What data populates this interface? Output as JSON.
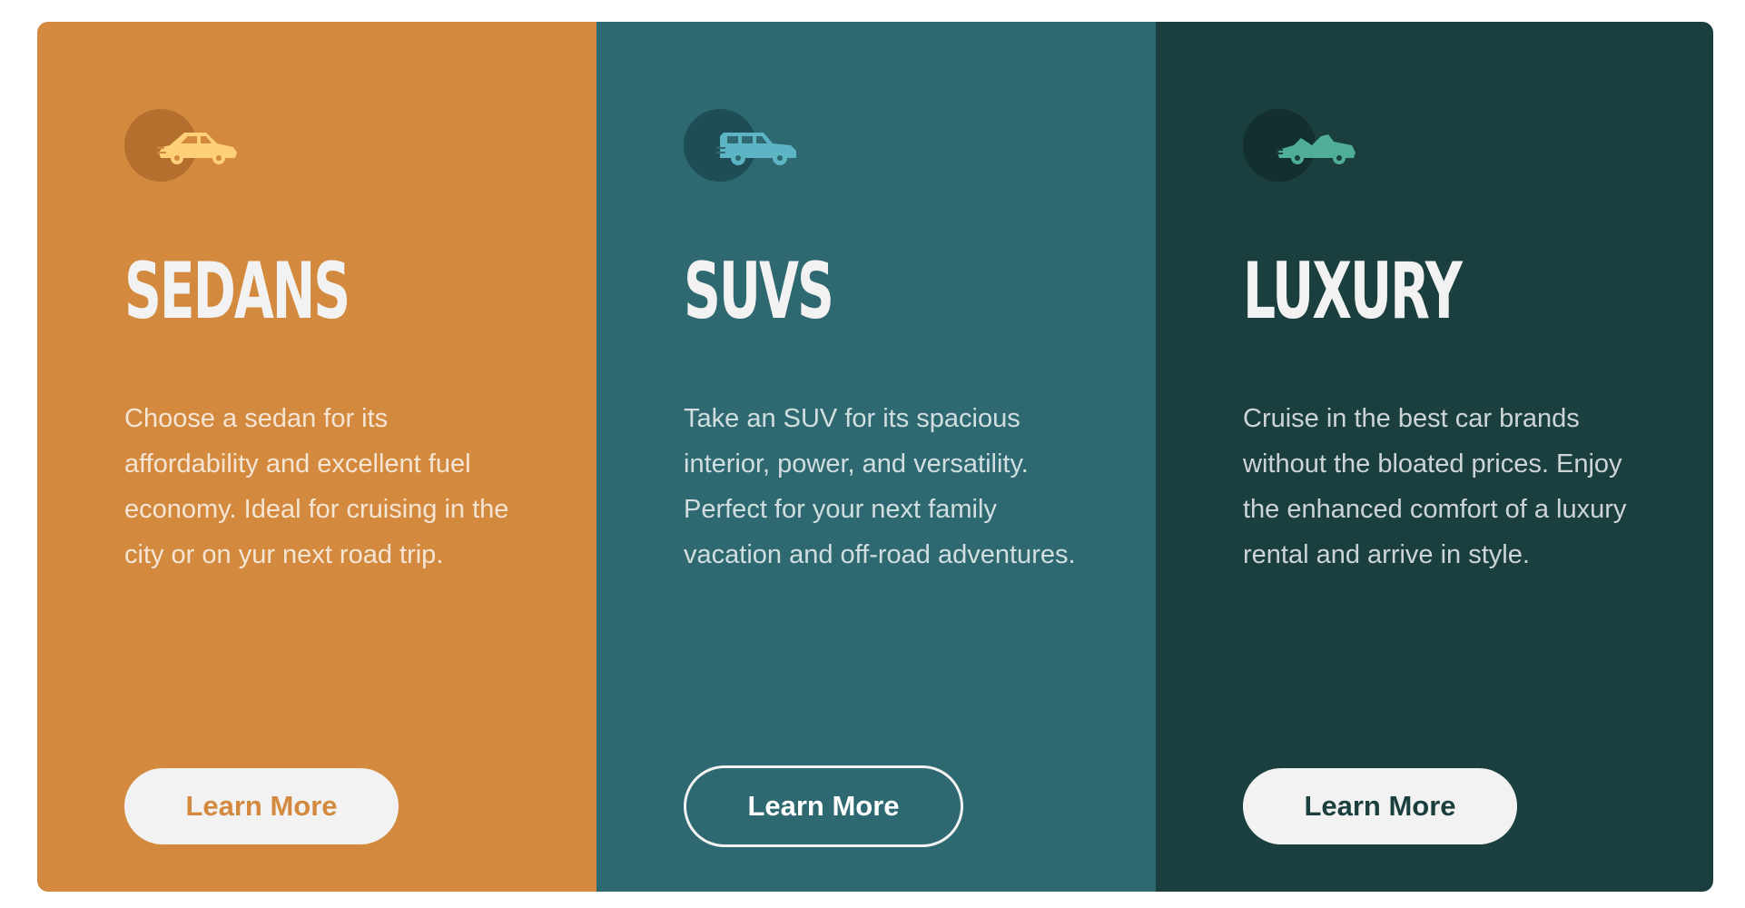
{
  "cards": [
    {
      "icon": "sedan-icon",
      "title": "SEDANS",
      "description": "Choose a sedan for its affordability and excellent fuel economy. Ideal for cruising in the city or on yur next road trip.",
      "button_label": "Learn More",
      "colors": {
        "background": "#d3893e",
        "icon_circle": "#b46f2f",
        "icon": "#ffd077",
        "button_text": "#d3893e"
      }
    },
    {
      "icon": "suv-icon",
      "title": "SUVS",
      "description": "Take an SUV for its spacious interior, power, and versatility. Perfect for your next family vacation and off-road adventures.",
      "button_label": "Learn More",
      "colors": {
        "background": "#2e6870",
        "icon_circle": "#1f4d55",
        "icon": "#5db4c4",
        "button_text": "#ffffff"
      }
    },
    {
      "icon": "convertible-icon",
      "title": "LUXURY",
      "description": "Cruise in the best car brands without the bloated prices. Enjoy the enhanced comfort of a luxury rental and arrive in style.",
      "button_label": "Learn More",
      "colors": {
        "background": "#1b3e3f",
        "icon_circle": "#132f30",
        "icon": "#4fae95",
        "button_text": "#1b3e3f"
      }
    }
  ]
}
